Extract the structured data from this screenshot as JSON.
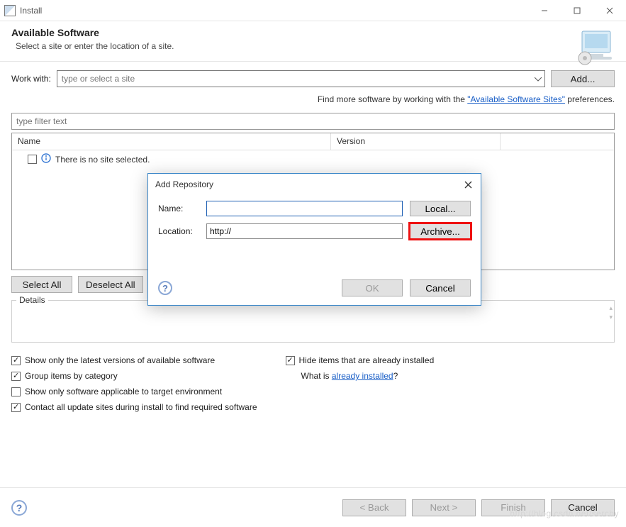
{
  "window": {
    "title": "Install"
  },
  "header": {
    "title": "Available Software",
    "subtitle": "Select a site or enter the location of a site."
  },
  "workwith": {
    "label": "Work with:",
    "placeholder": "type or select a site",
    "add_label": "Add..."
  },
  "hint": {
    "prefix": "Find more software by working with the ",
    "link": "\"Available Software Sites\"",
    "suffix": " preferences."
  },
  "filter": {
    "placeholder": "type filter text"
  },
  "grid": {
    "columns": {
      "name": "Name",
      "version": "Version"
    },
    "rows": [
      {
        "label": "There is no site selected."
      }
    ]
  },
  "selbtns": {
    "select_all": "Select All",
    "deselect_all": "Deselect All"
  },
  "details": {
    "label": "Details"
  },
  "opts": {
    "latest": "Show only the latest versions of available software",
    "group": "Group items by category",
    "target": "Show only software applicable to target environment",
    "contact": "Contact all update sites during install to find required software",
    "hide_installed": "Hide items that are already installed",
    "whatis_prefix": "What is ",
    "whatis_link": "already installed",
    "whatis_suffix": "?",
    "checked": {
      "latest": true,
      "group": true,
      "target": false,
      "contact": true,
      "hide": true
    }
  },
  "bottom": {
    "back": "< Back",
    "next": "Next >",
    "finish": "Finish",
    "cancel": "Cancel"
  },
  "modal": {
    "title": "Add Repository",
    "name_label": "Name:",
    "name_value": "",
    "location_label": "Location:",
    "location_value": "http://",
    "local_btn": "Local...",
    "archive_btn": "Archive...",
    "ok": "OK",
    "cancel": "Cancel"
  },
  "watermark": "http://blog.csdn.net/serchy"
}
